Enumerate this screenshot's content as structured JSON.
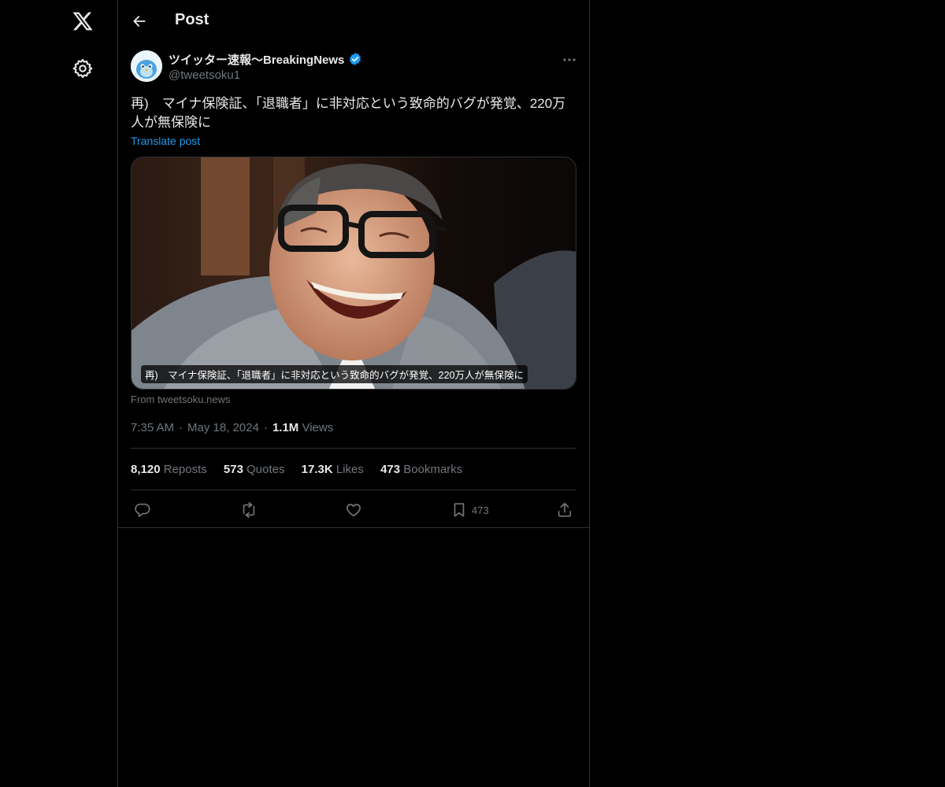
{
  "header": {
    "title": "Post"
  },
  "author": {
    "name": "ツイッター速報〜BreakingNews",
    "handle": "@tweetsoku1"
  },
  "post": {
    "text": "再)　マイナ保険証、「退職者」に非対応という致命的バグが発覚、220万人が無保険に",
    "translate_label": "Translate post",
    "media_caption": "再)　マイナ保険証、「退職者」に非対応という致命的バグが発覚、220万人が無保険に",
    "source": "From tweetsoku.news",
    "time": "7:35 AM",
    "date": "May 18, 2024",
    "views_count": "1.1M",
    "views_label": "Views"
  },
  "stats": {
    "reposts": {
      "count": "8,120",
      "label": "Reposts"
    },
    "quotes": {
      "count": "573",
      "label": "Quotes"
    },
    "likes": {
      "count": "17.3K",
      "label": "Likes"
    },
    "bookmarks": {
      "count": "473",
      "label": "Bookmarks"
    }
  },
  "actions": {
    "bookmark_count": "473"
  },
  "icons": [
    "x-logo-icon",
    "gear-icon",
    "back-arrow-icon",
    "verified-icon",
    "more-icon",
    "reply-icon",
    "repost-icon",
    "like-icon",
    "bookmark-icon",
    "share-icon"
  ],
  "colors": {
    "background": "#000000",
    "text": "#e7e9ea",
    "muted": "#71767b",
    "accent": "#1d9bf0",
    "border": "#2f3336"
  }
}
